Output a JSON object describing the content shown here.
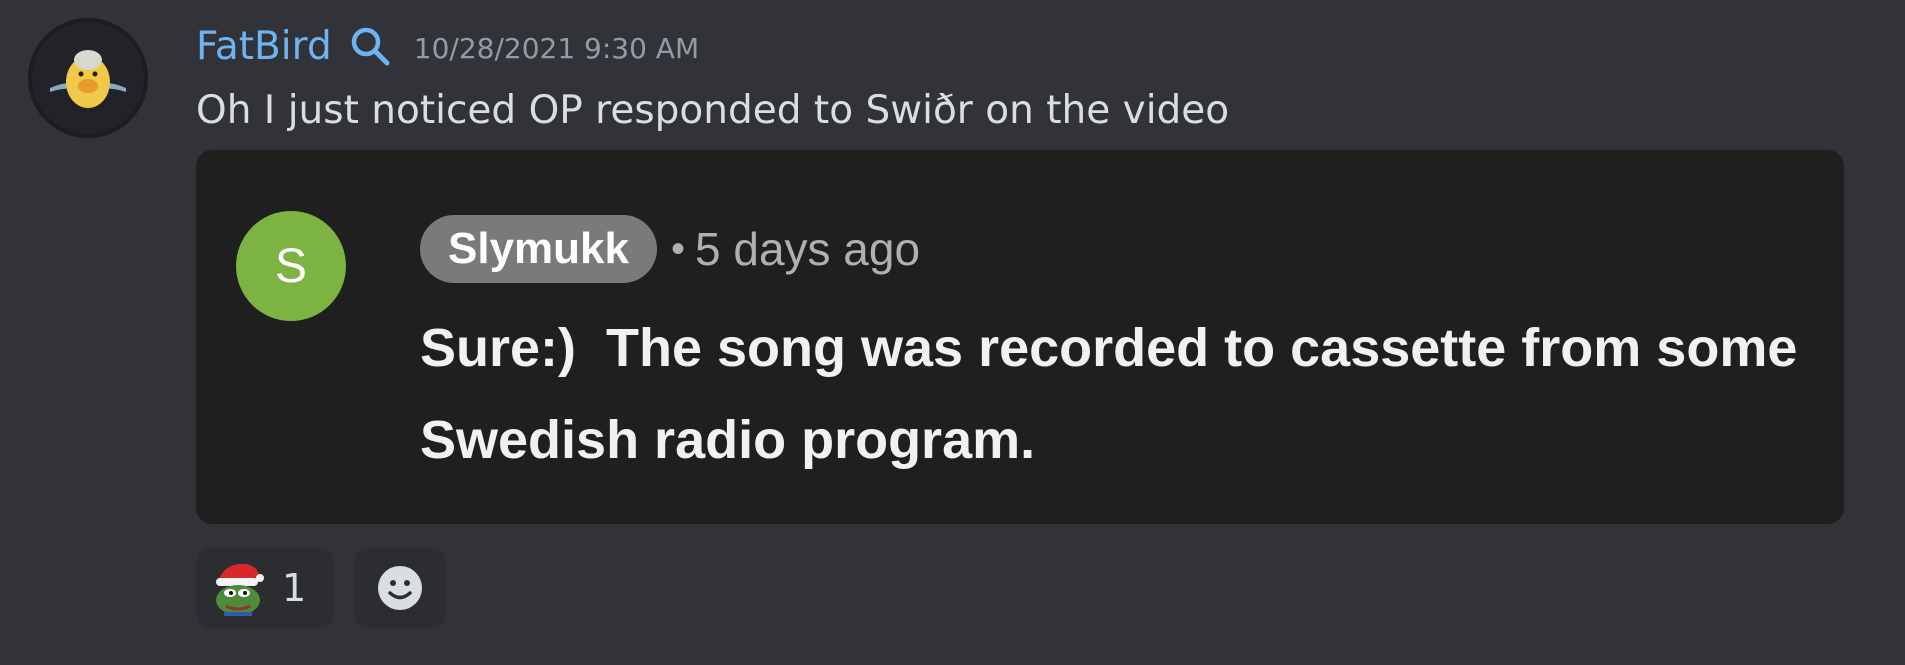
{
  "message": {
    "author": "FatBird",
    "author_color": "#6fb4f0",
    "author_icon": "search-icon",
    "timestamp": "10/28/2021 9:30 AM",
    "text": "Oh I just noticed OP responded to Swiðr on the video"
  },
  "embed": {
    "avatar_letter": "S",
    "avatar_color": "#7cb342",
    "author": "Slymukk",
    "separator": "•",
    "age": "5 days ago",
    "text": "Sure:)  The song was recorded to cassette from some Swedish radio program."
  },
  "reactions": [
    {
      "emoji": "pepe-santa-emoji",
      "count": "1"
    }
  ],
  "add_reaction_icon": "add-reaction-smiley-icon"
}
